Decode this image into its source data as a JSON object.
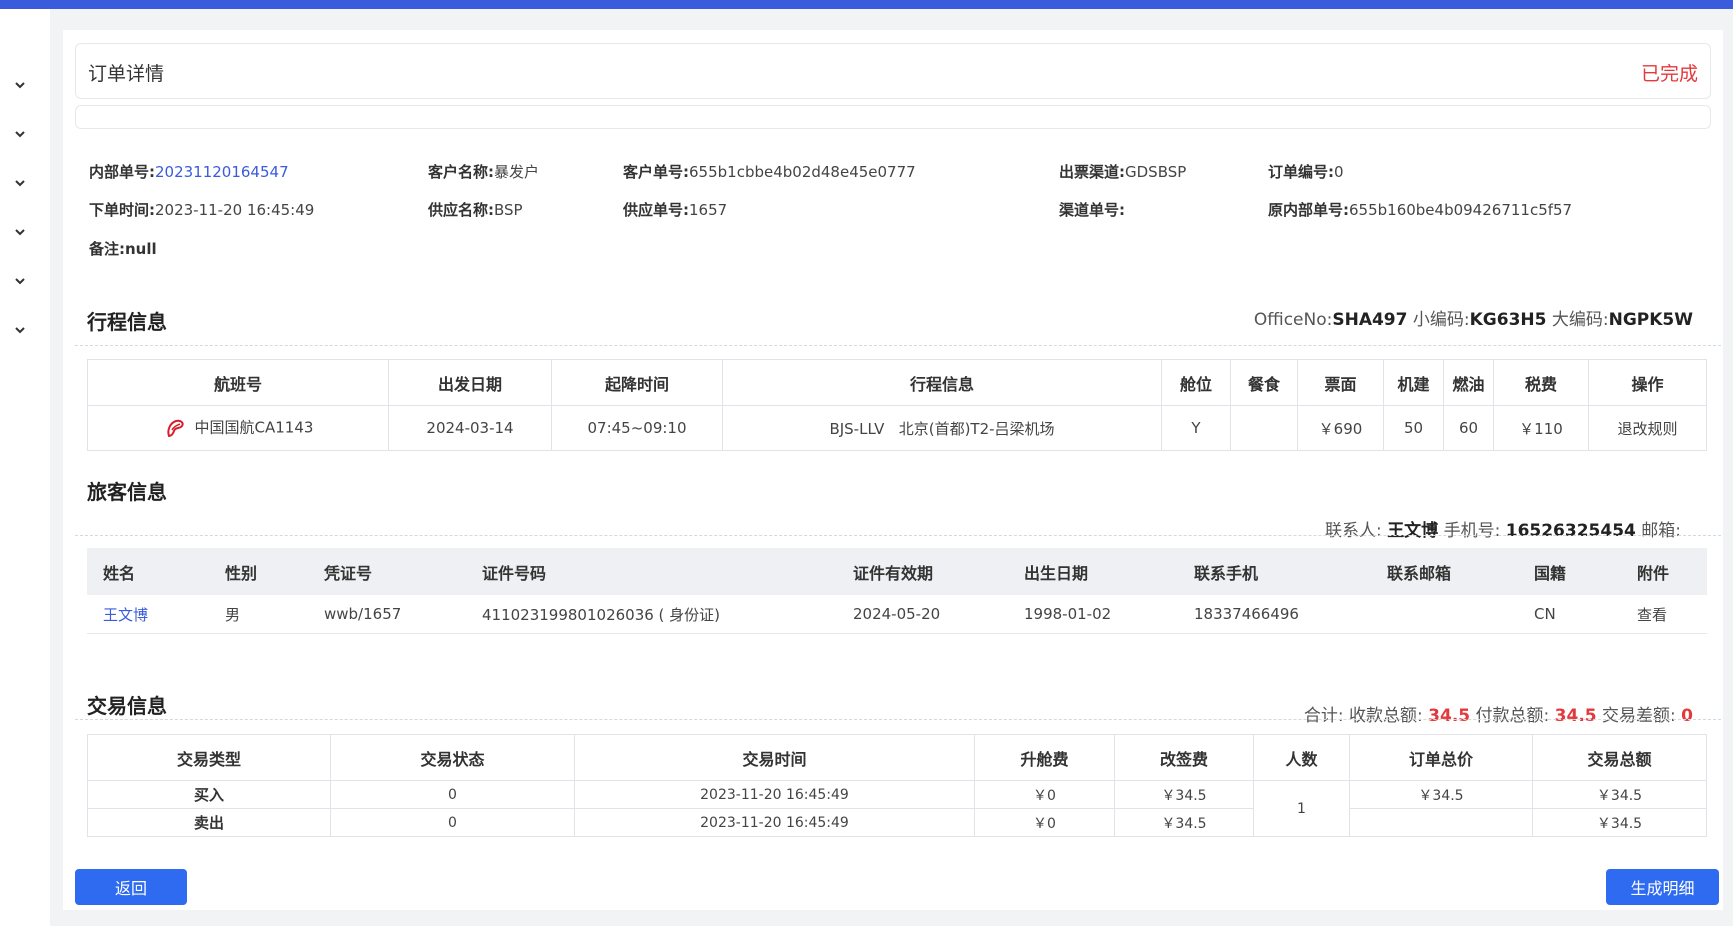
{
  "header": {
    "title": "订单详情",
    "status": "已完成"
  },
  "order_info": {
    "internal_no_label": "内部单号:",
    "internal_no": "20231120164547",
    "customer_name_label": "客户名称:",
    "customer_name": "暴发户",
    "customer_no_label": "客户单号:",
    "customer_no": "655b1cbbe4b02d48e45e0777",
    "channel_label": "出票渠道:",
    "channel": "GDSBSP",
    "order_code_label": "订单编号:",
    "order_code": "0",
    "order_time_label": "下单时间:",
    "order_time": "2023-11-20 16:45:49",
    "supplier_name_label": "供应名称:",
    "supplier_name": "BSP",
    "supplier_no_label": "供应单号:",
    "supplier_no": "1657",
    "channel_no_label": "渠道单号:",
    "channel_no": "",
    "orig_internal_no_label": "原内部单号:",
    "orig_internal_no": "655b160be4b09426711c5f57",
    "remark_label": "备注:",
    "remark": "null"
  },
  "itinerary": {
    "title": "行程信息",
    "office_label": "OfficeNo:",
    "office": "SHA497",
    "small_code_label": "小编码:",
    "small_code": "KG63H5",
    "big_code_label": "大编码:",
    "big_code": "NGPK5W",
    "headers": [
      "航班号",
      "出发日期",
      "起降时间",
      "行程信息",
      "舱位",
      "餐食",
      "票面",
      "机建",
      "燃油",
      "税费",
      "操作"
    ],
    "row": {
      "flight": "中国国航CA1143",
      "date": "2024-03-14",
      "time": "07:45~09:10",
      "route": "BJS-LLV   北京(首都)T2-吕梁机场",
      "cabin": "Y",
      "meal": "",
      "fare": "￥690",
      "airport_fee": "50",
      "fuel": "60",
      "tax": "￥110",
      "action": "退改规则"
    }
  },
  "passenger": {
    "title": "旅客信息",
    "contact_label": "联系人:",
    "contact": "王文博",
    "phone_label": "手机号:",
    "phone": "16526325454",
    "email_label": "邮箱:",
    "email": "",
    "headers": [
      "姓名",
      "性别",
      "凭证号",
      "证件号码",
      "证件有效期",
      "出生日期",
      "联系手机",
      "联系邮箱",
      "国籍",
      "附件"
    ],
    "row": {
      "name": "王文博",
      "gender": "男",
      "voucher": "wwb/1657",
      "id_no": "411023199801026036 ( 身份证)",
      "id_expiry": "2024-05-20",
      "birth": "1998-01-02",
      "mobile": "18337466496",
      "email": "",
      "nationality": "CN",
      "attachment": "查看"
    }
  },
  "trade": {
    "title": "交易信息",
    "total_label": "合计:",
    "receive_label": "收款总额:",
    "receive": "34.5",
    "pay_label": "付款总额:",
    "pay": "34.5",
    "diff_label": "交易差额:",
    "diff": "0",
    "headers": [
      "交易类型",
      "交易状态",
      "交易时间",
      "升舱费",
      "改签费",
      "人数",
      "订单总价",
      "交易总额"
    ],
    "rows": [
      {
        "type": "买入",
        "status": "0",
        "time": "2023-11-20 16:45:49",
        "upgrade": "￥0",
        "change": "￥34.5",
        "order_total": "￥34.5",
        "trade_total": "￥34.5"
      },
      {
        "type": "卖出",
        "status": "0",
        "time": "2023-11-20 16:45:49",
        "upgrade": "￥0",
        "change": "￥34.5",
        "order_total": "",
        "trade_total": "￥34.5"
      }
    ],
    "people": "1"
  },
  "buttons": {
    "back": "返回",
    "generate": "生成明细"
  },
  "colors": {
    "accent": "#2e6bf0",
    "topbar": "#3a5bdc",
    "status_red": "#e4393c",
    "link": "#3a5bdc"
  }
}
